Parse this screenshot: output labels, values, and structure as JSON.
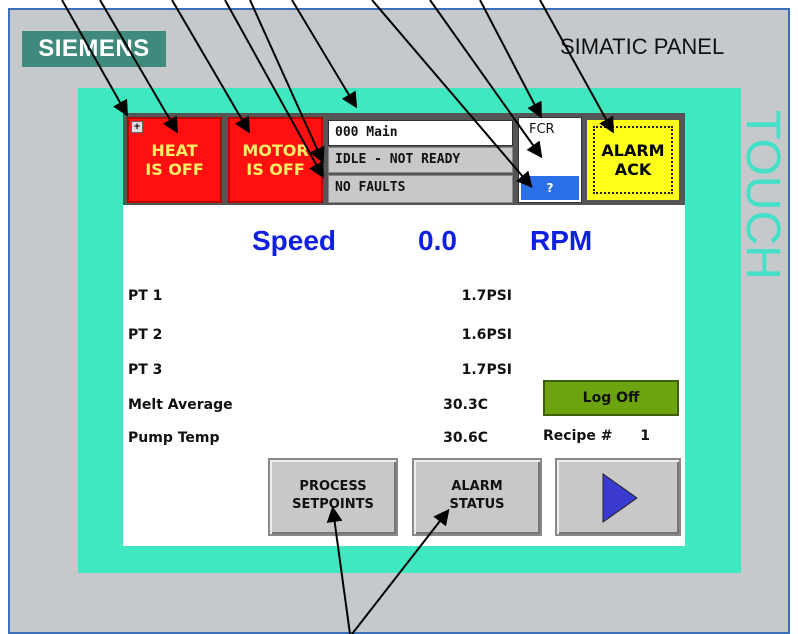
{
  "device": {
    "brand": "SIEMENS",
    "model": "SIMATIC PANEL",
    "side_label": "TOUCH"
  },
  "header": {
    "heat": {
      "line1": "HEAT",
      "line2": "IS OFF"
    },
    "motor": {
      "line1": "MOTOR",
      "line2": "IS OFF"
    },
    "screen_name": "000 Main",
    "machine_state": "IDLE - NOT READY",
    "fault_state": "NO FAULTS",
    "fcr_label": "FCR",
    "help_label": "?",
    "alarm_ack": {
      "line1": "ALARM",
      "line2": "ACK"
    }
  },
  "speed": {
    "label": "Speed",
    "value": "0.0",
    "unit": "RPM"
  },
  "readings": [
    {
      "label": "PT 1",
      "value": "1.7",
      "unit": "PSI"
    },
    {
      "label": "PT 2",
      "value": "1.6",
      "unit": "PSI"
    },
    {
      "label": "PT 3",
      "value": "1.7",
      "unit": "PSI"
    },
    {
      "label": "Melt Average",
      "value": "30.3",
      "unit": "C"
    },
    {
      "label": "Pump Temp",
      "value": "30.6",
      "unit": "C"
    }
  ],
  "log_off_label": "Log Off",
  "recipe": {
    "label": "Recipe #",
    "value": "1"
  },
  "buttons": {
    "process_setpoints": {
      "line1": "PROCESS",
      "line2": "SETPOINTS"
    },
    "alarm_status": {
      "line1": "ALARM",
      "line2": "STATUS"
    }
  },
  "colors": {
    "bezel": "#3fe8c0",
    "status_red": "#ff1010",
    "alarm_yellow": "#ffff1a",
    "speed_blue": "#1020e0",
    "logoff_green": "#6ea310",
    "next_arrow": "#3a3ad0"
  }
}
